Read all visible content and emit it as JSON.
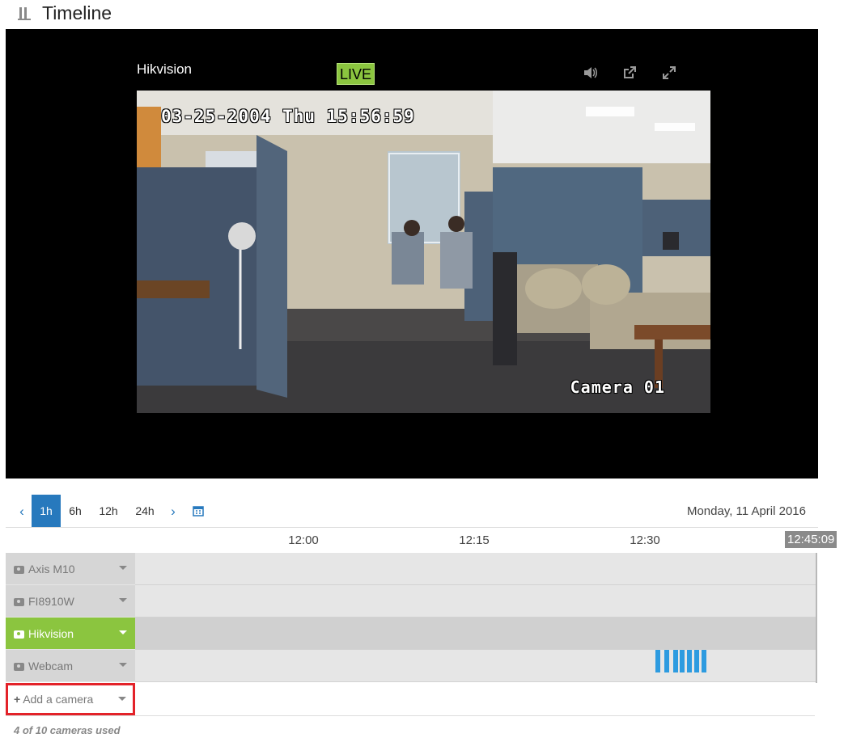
{
  "page": {
    "title": "Timeline"
  },
  "player": {
    "camera_name": "Hikvision",
    "live_label": "LIVE",
    "controls": [
      "volume-icon",
      "popout-icon",
      "fullscreen-icon"
    ],
    "osd_timestamp": "03-25-2004 Thu 15:56:59",
    "osd_camera": "Camera 01"
  },
  "range": {
    "prev_icon": "chevron-left-icon",
    "next_icon": "chevron-right-icon",
    "calendar_icon": "calendar-icon",
    "options": [
      "1h",
      "6h",
      "12h",
      "24h"
    ],
    "selected": "1h",
    "date": "Monday, 11 April 2016"
  },
  "timeline": {
    "ticks": [
      "12:00",
      "12:15",
      "12:30"
    ],
    "current_time": "12:45:09",
    "cameras": [
      {
        "name": "Axis M10",
        "selected": false,
        "has_recordings": false
      },
      {
        "name": "FI8910W",
        "selected": false,
        "has_recordings": false
      },
      {
        "name": "Hikvision",
        "selected": true,
        "has_recordings": false
      },
      {
        "name": "Webcam",
        "selected": false,
        "has_recordings": true
      }
    ],
    "add_camera_label": "Add a camera",
    "usage": "4 of 10 cameras used"
  },
  "colors": {
    "accent": "#2779bd",
    "selected": "#8bc53f",
    "recording": "#2d9be0",
    "highlight": "#e32229"
  }
}
